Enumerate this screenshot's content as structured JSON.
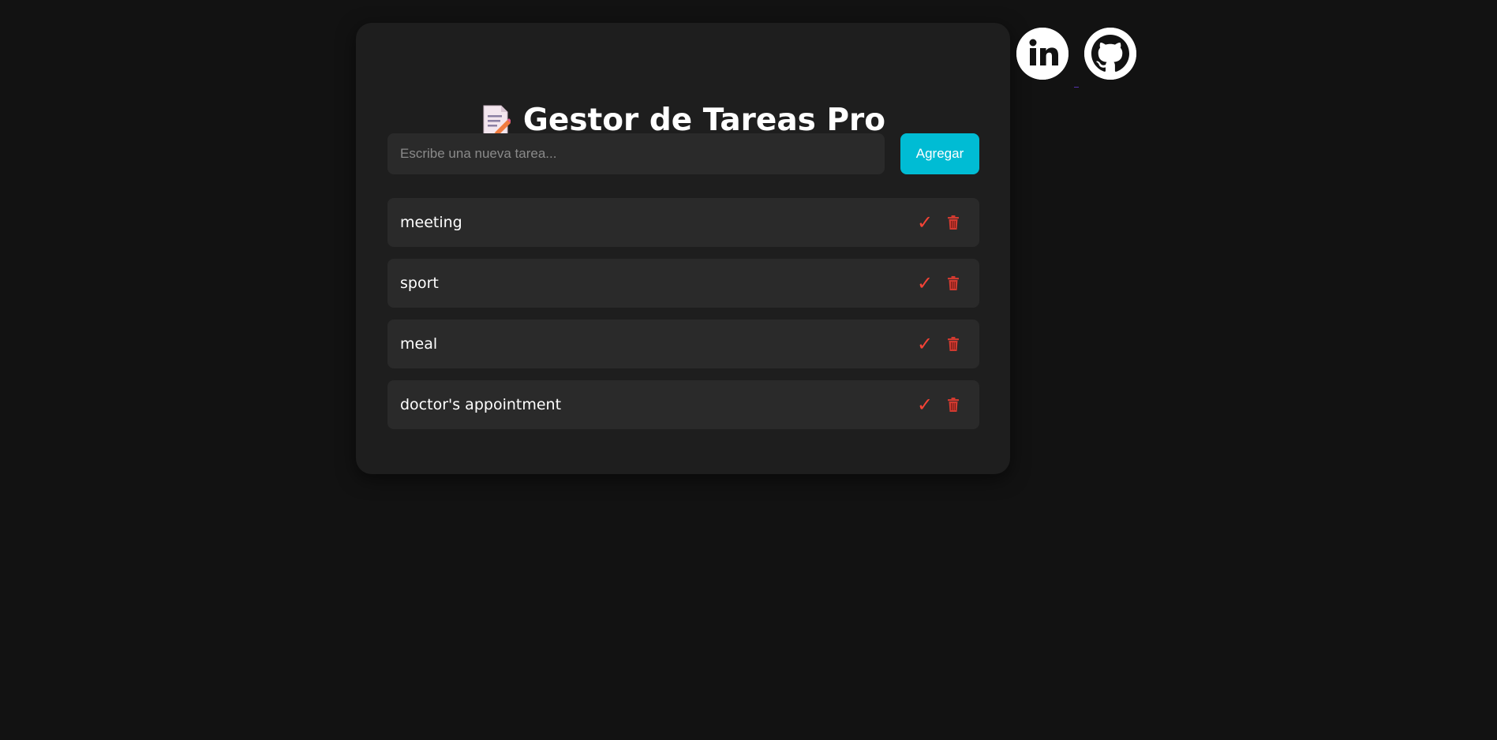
{
  "app": {
    "title": "Gestor de Tareas Pro",
    "title_icon": "memo-icon"
  },
  "new_task": {
    "placeholder": "Escribe una nueva tarea...",
    "value": "",
    "add_label": "Agregar"
  },
  "tasks": [
    {
      "text": "meeting"
    },
    {
      "text": "sport"
    },
    {
      "text": "meal"
    },
    {
      "text": "doctor's appointment"
    }
  ],
  "task_actions": {
    "complete_glyph": "✓",
    "complete_icon": "checkmark-icon",
    "delete_icon": "trash-icon"
  },
  "social_links": [
    {
      "name": "linkedin",
      "icon": "linkedin-icon"
    },
    {
      "name": "github",
      "icon": "github-icon"
    }
  ],
  "colors": {
    "background": "#121212",
    "card": "#1e1e1e",
    "item": "#2a2a2a",
    "accent": "#00bcd4",
    "action": "#f44336",
    "text": "#ffffff"
  }
}
